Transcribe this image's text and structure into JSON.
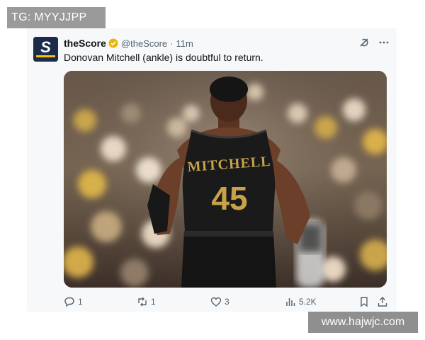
{
  "watermarks": {
    "top": "TG: MYYJJPP",
    "bottom": "www.hajwjc.com"
  },
  "tweet": {
    "display_name": "theScore",
    "handle": "@theScore",
    "separator": "·",
    "timestamp": "11m",
    "text": "Donovan Mitchell (ankle) is doubtful to return.",
    "avatar_letter": "S",
    "media": {
      "jersey_name": "MITCHELL",
      "jersey_number": "45"
    },
    "actions": {
      "replies": "1",
      "retweets": "1",
      "likes": "3",
      "views": "5.2K"
    }
  },
  "colors": {
    "avatar_bg": "#1c2b4a",
    "avatar_accent": "#f5c400",
    "verified": "#e9b50a",
    "jersey": "#1a1a1a",
    "jersey_text": "#c8a24a",
    "muted_text": "#536471"
  },
  "icons": [
    "verified-badge-icon",
    "grok-icon",
    "more-icon",
    "reply-icon",
    "retweet-icon",
    "like-icon",
    "views-icon",
    "bookmark-icon",
    "share-icon"
  ]
}
